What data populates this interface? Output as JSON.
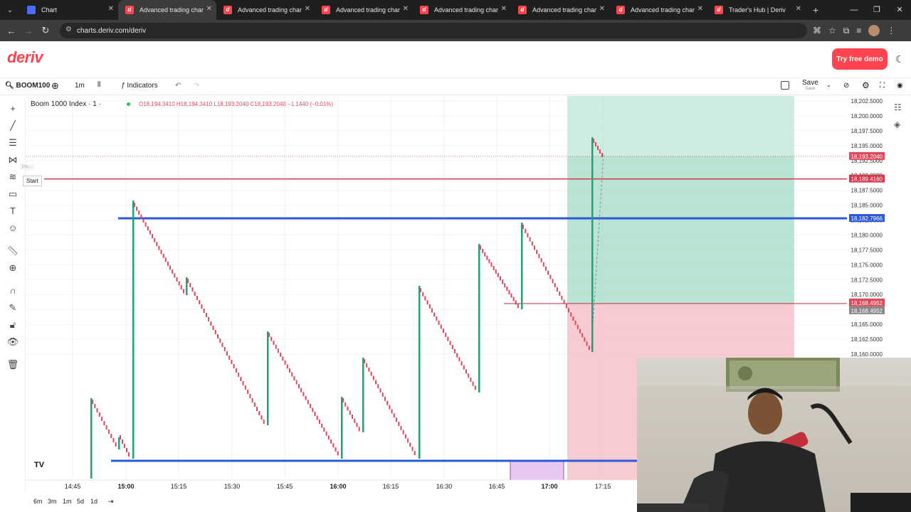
{
  "browser": {
    "tabs": [
      {
        "label": "Chart",
        "icon": "chart-icon",
        "active": false
      },
      {
        "label": "Advanced trading charts",
        "icon": "deriv-icon",
        "active": true
      },
      {
        "label": "Advanced trading charts",
        "icon": "deriv-icon",
        "active": false
      },
      {
        "label": "Advanced trading charts",
        "icon": "deriv-icon",
        "active": false
      },
      {
        "label": "Advanced trading charts",
        "icon": "deriv-icon",
        "active": false
      },
      {
        "label": "Advanced trading charts",
        "icon": "deriv-icon",
        "active": false
      },
      {
        "label": "Advanced trading charts",
        "icon": "deriv-icon",
        "active": false
      },
      {
        "label": "Trader's Hub | Deriv",
        "icon": "deriv-icon",
        "active": false
      }
    ],
    "url": "charts.deriv.com/deriv"
  },
  "header": {
    "logo": "deriv",
    "try_demo": "Try free demo"
  },
  "toolbar": {
    "symbol": "BOOM100",
    "interval": "1m",
    "indicators": "Indicators",
    "save": "Save",
    "save_sub": "Save"
  },
  "legend": {
    "name": "Boom 1000 Index · 1 ·",
    "ohlc": "O18,194.3410 H18,194.3410 L18,193.2040 C18,193.2040 −1.1440 (−0.01%)"
  },
  "tooltips": {
    "start": "Start",
    "poi": "Poi..."
  },
  "colors": {
    "up": "#22a079",
    "down": "#e0475a",
    "blue_line": "#2b59d9",
    "red_line": "#d9344a",
    "profit_zone": "#a8dcc6",
    "loss_zone": "#f6c5cc",
    "accent": "#ff444f"
  },
  "price_axis": {
    "ticks": [
      "18,202.5000",
      "18,200.0000",
      "18,197.5000",
      "18,195.0000",
      "18,192.5000",
      "18,190.0000",
      "18,187.5000",
      "18,185.0000",
      "18,182.5000",
      "18,180.0000",
      "18,177.5000",
      "18,175.0000",
      "18,172.5000",
      "18,170.0000",
      "18,167.5000",
      "18,165.0000",
      "18,162.5000",
      "18,160.0000"
    ],
    "tags": [
      {
        "label": "18,193.2040",
        "color": "#e0475a"
      },
      {
        "label": "18,189.4160",
        "color": "#d9344a"
      },
      {
        "label": "18,182.7966",
        "color": "#2b59d9"
      },
      {
        "label": "18,168.4952",
        "color": "#e0475a"
      },
      {
        "label": "18,168.4952",
        "color": "#888888"
      }
    ]
  },
  "time_axis": {
    "ticks": [
      "14:45",
      "15:00",
      "15:15",
      "15:30",
      "15:45",
      "16:00",
      "16:15",
      "16:30",
      "16:45",
      "17:00",
      "17:15"
    ]
  },
  "ranges": [
    "6m",
    "3m",
    "1m",
    "5d",
    "1d"
  ],
  "chart_data": {
    "type": "candlestick",
    "ylim": [
      18159,
      18203.5
    ],
    "series_note": "",
    "levels": [
      18193.204,
      18189.416,
      18182.7966,
      18168.4952
    ]
  }
}
